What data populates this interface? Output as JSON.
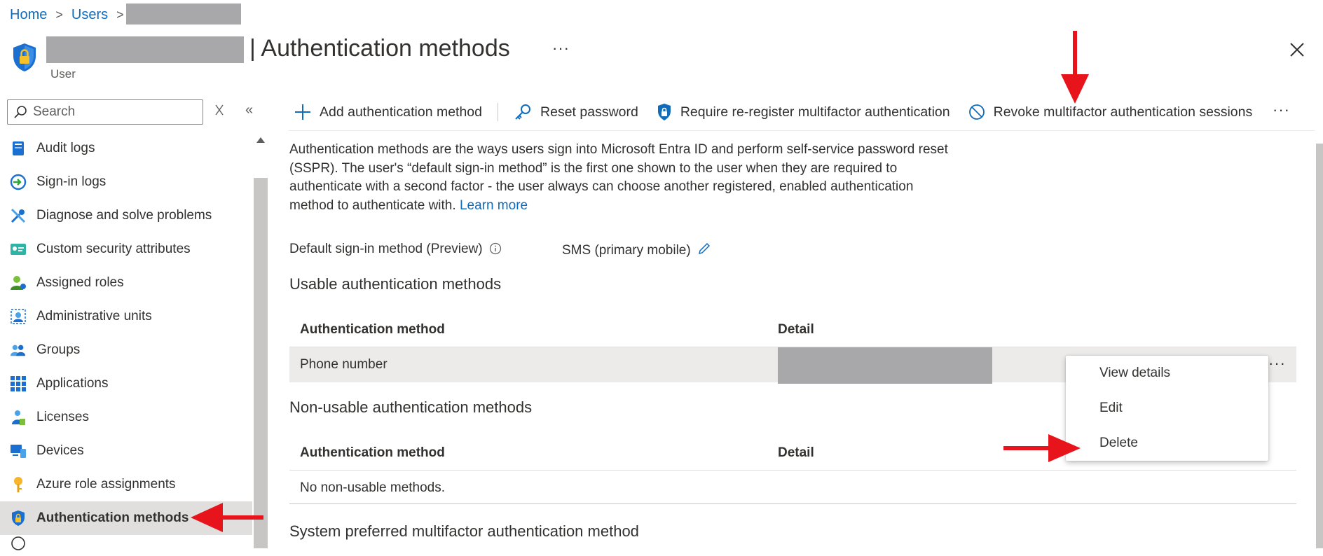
{
  "breadcrumb": {
    "home": "Home",
    "users": "Users"
  },
  "header": {
    "title": "| Authentication methods",
    "subtitle": "User",
    "more": "···"
  },
  "nav": {
    "search_placeholder": "Search",
    "items": [
      {
        "label": "Audit logs",
        "icon": "audit-logs-icon"
      },
      {
        "label": "Sign-in logs",
        "icon": "sign-in-logs-icon"
      },
      {
        "label": "Diagnose and solve problems",
        "icon": "wrench-icon"
      },
      {
        "label": "Custom security attributes",
        "icon": "security-attributes-icon"
      },
      {
        "label": "Assigned roles",
        "icon": "assigned-roles-icon"
      },
      {
        "label": "Administrative units",
        "icon": "administrative-units-icon"
      },
      {
        "label": "Groups",
        "icon": "groups-icon"
      },
      {
        "label": "Applications",
        "icon": "applications-grid-icon"
      },
      {
        "label": "Licenses",
        "icon": "licenses-icon"
      },
      {
        "label": "Devices",
        "icon": "devices-icon"
      },
      {
        "label": "Azure role assignments",
        "icon": "key-icon"
      },
      {
        "label": "Authentication methods",
        "icon": "shield-lock-icon",
        "active": true
      }
    ]
  },
  "toolbar": {
    "add": "Add authentication method",
    "reset": "Reset password",
    "require": "Require re-register multifactor authentication",
    "revoke": "Revoke multifactor authentication sessions",
    "more": "···"
  },
  "content": {
    "description": "Authentication methods are the ways users sign into Microsoft Entra ID and perform self-service password reset (SSPR). The user's “default sign-in method” is the first one shown to the user when they are required to authenticate with a second factor - the user always can choose another registered, enabled authentication method to authenticate with.",
    "learn_more": "Learn more",
    "default_label": "Default sign-in method (Preview)",
    "default_value": "SMS (primary mobile)",
    "usable_heading": "Usable authentication methods",
    "nonusable_heading": "Non-usable authentication methods",
    "system_heading": "System preferred multifactor authentication method",
    "col_method": "Authentication method",
    "col_detail": "Detail",
    "usable_rows": [
      {
        "method": "Phone number",
        "detail": ""
      }
    ],
    "nonusable_empty": "No non-usable methods.",
    "row_more": "···"
  },
  "menu": {
    "view": "View details",
    "edit": "Edit",
    "delete": "Delete"
  },
  "colors": {
    "accent": "#0f6cbd",
    "arrow": "#e8141b",
    "redaction": "#a8a8aa"
  }
}
